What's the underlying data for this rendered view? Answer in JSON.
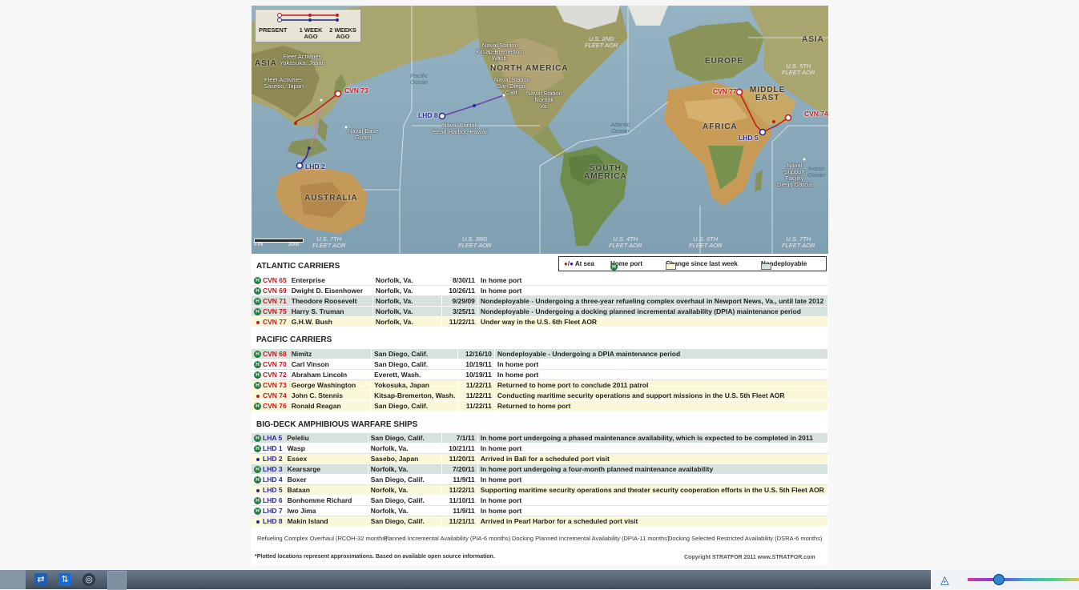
{
  "map": {
    "legend": {
      "present": "PRESENT",
      "one_week": "1 WEEK",
      "one_week_b": "AGO",
      "two_weeks": "2 WEEKS",
      "two_weeks_b": "AGO"
    },
    "scale": {
      "start": "0 mi",
      "end": "2000"
    },
    "regions": {
      "asia_left": "ASIA",
      "asia_right": "ASIA",
      "north_america": "NORTH AMERICA",
      "europe": "EUROPE",
      "middle_east_a": "MIDDLE",
      "middle_east_b": "EAST",
      "africa": "AFRICA",
      "south_america_a": "SOUTH",
      "south_america_b": "AMERICA",
      "australia": "AUSTRALIA"
    },
    "oceans": {
      "pacific_a": "Pacific",
      "pacific_b": "Ocean",
      "atlantic_a": "Atlantic",
      "atlantic_b": "Ocean",
      "indian_a": "Indian",
      "indian_b": "Ocean"
    },
    "fleets": {
      "f7a": "U.S. 7TH",
      "f7b": "FLEET AOR",
      "f3a": "U.S. 3RD",
      "f3b": "FLEET AOR",
      "f4a": "U.S. 4TH",
      "f4b": "FLEET AOR",
      "f6a": "U.S. 6TH",
      "f6b": "FLEET AOR",
      "f7ra": "U.S. 7TH",
      "f7rb": "FLEET AOR",
      "f2a": "U.S. 2ND",
      "f2b": "FLEET AOR",
      "f5a": "U.S. 5TH",
      "f5b": "FLEET AOR"
    },
    "places": {
      "yokosuka": "Fleet Activities\nYokosuka, Japan",
      "sasebo": "Fleet Activities\nSasebo, Japan",
      "guam": "Naval Base\nGuam",
      "kitsap": "Naval Station\nKitsap-Bremerton,\nWash.",
      "sandiego": "Naval Station\nSan Diego,\nCalif.",
      "norfolk": "Naval Station\nNorfolk\nVa.",
      "pearl": "Naval Station\nPearl Harbor, Hawaii",
      "diego_garcia": "Naval\nSupport\nFacility\nDiego Garcia"
    },
    "ships": {
      "cvn73": "CVN 73",
      "lhd8": "LHD 8",
      "lhd2": "LHD 2",
      "cvn77": "CVN 77",
      "lhd5": "LHD 5",
      "cvn74": "CVN 74"
    }
  },
  "legend": {
    "at_sea": "At sea",
    "home_port": "Home port",
    "change": "Change since last week",
    "nondeployable": "Nondeployable"
  },
  "sections": [
    {
      "title": "ATLANTIC CARRIERS",
      "rows": [
        {
          "status": "home",
          "hull": "CVN 65",
          "name": "Enterprise",
          "port": "Norfolk, Va.",
          "date": "8/30/11",
          "note": "In home port",
          "shade": "w"
        },
        {
          "status": "home",
          "hull": "CVN 69",
          "name": "Dwight D. Eisenhower",
          "port": "Norfolk, Va.",
          "date": "10/26/11",
          "note": "In home port",
          "shade": "w"
        },
        {
          "status": "home",
          "hull": "CVN 71",
          "name": "Theodore Roosevelt",
          "port": "Norfolk, Va.",
          "date": "9/29/09",
          "note": "Nondeployable - Undergoing a three-year refueling complex overhaul in Newport News, Va., until late 2012",
          "shade": "g"
        },
        {
          "status": "home",
          "hull": "CVN 75",
          "name": "Harry S. Truman",
          "port": "Norfolk, Va.",
          "date": "3/25/11",
          "note": "Nondeployable - Undergoing a docking planned incremental availability (DPIA) maintenance period",
          "shade": "g"
        },
        {
          "status": "sea",
          "hull": "CVN 77",
          "name": "G.H.W. Bush",
          "port": "Norfolk, Va.",
          "date": "11/22/11",
          "note": "Under way in the U.S. 6th Fleet AOR",
          "shade": "y"
        }
      ]
    },
    {
      "title": "PACIFIC CARRIERS",
      "rows": [
        {
          "status": "home",
          "hull": "CVN 68",
          "name": "Nimitz",
          "port": "San Diego, Calif.",
          "date": "12/16/10",
          "note": "Nondeployable - Undergoing a DPIA maintenance period",
          "shade": "g"
        },
        {
          "status": "home",
          "hull": "CVN 70",
          "name": "Carl Vinson",
          "port": "San Diego, Calif.",
          "date": "10/19/11",
          "note": "In home port",
          "shade": "w"
        },
        {
          "status": "home",
          "hull": "CVN 72",
          "name": "Abraham Lincoln",
          "port": "Everett, Wash.",
          "date": "10/19/11",
          "note": "In home port",
          "shade": "w"
        },
        {
          "status": "home",
          "hull": "CVN 73",
          "name": "George Washington",
          "port": "Yokosuka, Japan",
          "date": "11/22/11",
          "note": "Returned to home port to conclude 2011 patrol",
          "shade": "y"
        },
        {
          "status": "sea",
          "hull": "CVN 74",
          "name": "John C. Stennis",
          "port": "Kitsap-Bremerton, Wash.",
          "date": "11/22/11",
          "note": "Conducting maritime security operations and support missions in the U.S. 5th Fleet AOR",
          "shade": "y"
        },
        {
          "status": "home",
          "hull": "CVN 76",
          "name": "Ronald Reagan",
          "port": "San Diego, Calif.",
          "date": "11/22/11",
          "note": "Returned to home port",
          "shade": "y"
        }
      ]
    },
    {
      "title": "BIG-DECK AMPHIBIOUS WARFARE SHIPS",
      "rows": [
        {
          "status": "home",
          "hull": "LHA 5",
          "name": "Peleliu",
          "port": "San Diego, Calif.",
          "date": "7/1/11",
          "note": "In home port undergoing a phased maintenance availability, which is expected to be completed in  2011",
          "shade": "g"
        },
        {
          "status": "home",
          "hull": "LHD 1",
          "name": "Wasp",
          "port": "Norfolk, Va.",
          "date": "10/21/11",
          "note": "In home port",
          "shade": "w"
        },
        {
          "status": "sea",
          "hull": "LHD 2",
          "name": "Essex",
          "port": "Sasebo, Japan",
          "date": "11/20/11",
          "note": "Arrived in Bali for a scheduled port visit",
          "shade": "y"
        },
        {
          "status": "home",
          "hull": "LHD 3",
          "name": "Kearsarge",
          "port": "Norfolk, Va.",
          "date": "7/20/11",
          "note": "In home port undergoing a four-month planned maintenance availability",
          "shade": "g"
        },
        {
          "status": "home",
          "hull": "LHD 4",
          "name": "Boxer",
          "port": "San Diego, Calif.",
          "date": "11/9/11",
          "note": "In home port",
          "shade": "w"
        },
        {
          "status": "sea",
          "hull": "LHD 5",
          "name": "Bataan",
          "port": "Norfolk, Va.",
          "date": "11/22/11",
          "note": "Supporting maritime security operations and theater security cooperation efforts in the U.S. 5th Fleet AOR",
          "shade": "y"
        },
        {
          "status": "home",
          "hull": "LHD 6",
          "name": "Bonhomme Richard",
          "port": "San Diego, Calif.",
          "date": "11/10/11",
          "note": "In home port",
          "shade": "w"
        },
        {
          "status": "home",
          "hull": "LHD 7",
          "name": "Iwo Jima",
          "port": "Norfolk, Va.",
          "date": "11/9/11",
          "note": "In home port",
          "shade": "w"
        },
        {
          "status": "sea",
          "hull": "LHD 8",
          "name": "Makin Island",
          "port": "San Diego, Calif.",
          "date": "11/21/11",
          "note": "Arrived in Pearl Harbor for a scheduled port visit",
          "shade": "y"
        }
      ]
    }
  ],
  "footer": {
    "defs": [
      "Refueling Complex Overhaul (RCOH-32 months)",
      "Planned Incremental Availability (PIA-6 months)",
      "Docking Planned Incremental Availability (DPIA-11 months)",
      "Docking Selected Restricted Availability (DSRA-6 months)"
    ],
    "note": "*Plotted locations represent approximations. Based on available open source information.",
    "copyright": "Copyright STRATFOR 2011   www.STRATFOR.com"
  },
  "colors": {
    "at_sea_red": "#c0191e",
    "at_sea_blue": "#27288f",
    "home_green": "#1f7a3b",
    "change_yellow": "#fbf8d9",
    "nondeployable": "#d7e2de"
  }
}
